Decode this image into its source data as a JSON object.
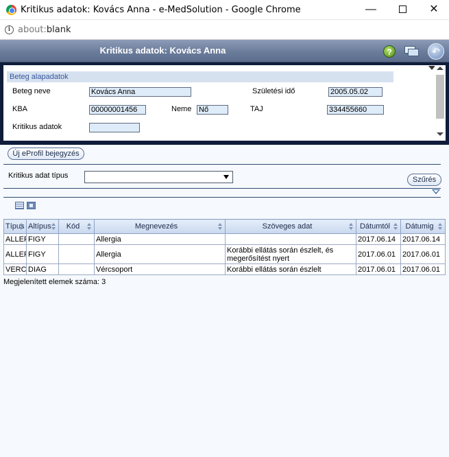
{
  "browser": {
    "window_title": "Kritikus adatok: Kovács Anna - e-MedSolution - Google Chrome",
    "url_scheme": "about:",
    "url_rest": "blank",
    "minimize_glyph": "—",
    "close_glyph": "✕"
  },
  "app": {
    "title": "Kritikus adatok: Kovács Anna",
    "help_glyph": "?",
    "back_glyph": "↶"
  },
  "patient": {
    "section_title": "Beteg alapadatok",
    "name_label": "Beteg neve",
    "name_value": "Kovács Anna",
    "birth_label": "Születési idő",
    "birth_value": "2005.05.02",
    "kba_label": "KBA",
    "kba_value": "00000001456",
    "sex_label": "Neme",
    "sex_value": "Nő",
    "taj_label": "TAJ",
    "taj_value": "334455660",
    "critical_label": "Kritikus adatok",
    "critical_value": ""
  },
  "toolbar": {
    "new_button": "Új eProfil bejegyzés",
    "filter_label": "Kritikus adat típus",
    "filter_selected": "",
    "filter_button": "Szűrés"
  },
  "table": {
    "columns": [
      "Típus",
      "Altípus",
      "Kód",
      "Megnevezés",
      "Szöveges adat",
      "Dátumtól",
      "Dátumig"
    ],
    "rows": [
      [
        "ALLER",
        "FIGY",
        "",
        "Allergia",
        "",
        "2017.06.14",
        "2017.06.14"
      ],
      [
        "ALLER",
        "FIGY",
        "",
        "Allergia",
        "Korábbi ellátás során észlelt, és megerősítést nyert",
        "2017.06.01",
        "2017.06.01"
      ],
      [
        "VERC",
        "DIAG",
        "",
        "Vércsoport",
        "Korábbi ellátás során észlelt",
        "2017.06.01",
        "2017.06.01"
      ]
    ],
    "count_text": "Megjelenített elemek száma: 3"
  }
}
